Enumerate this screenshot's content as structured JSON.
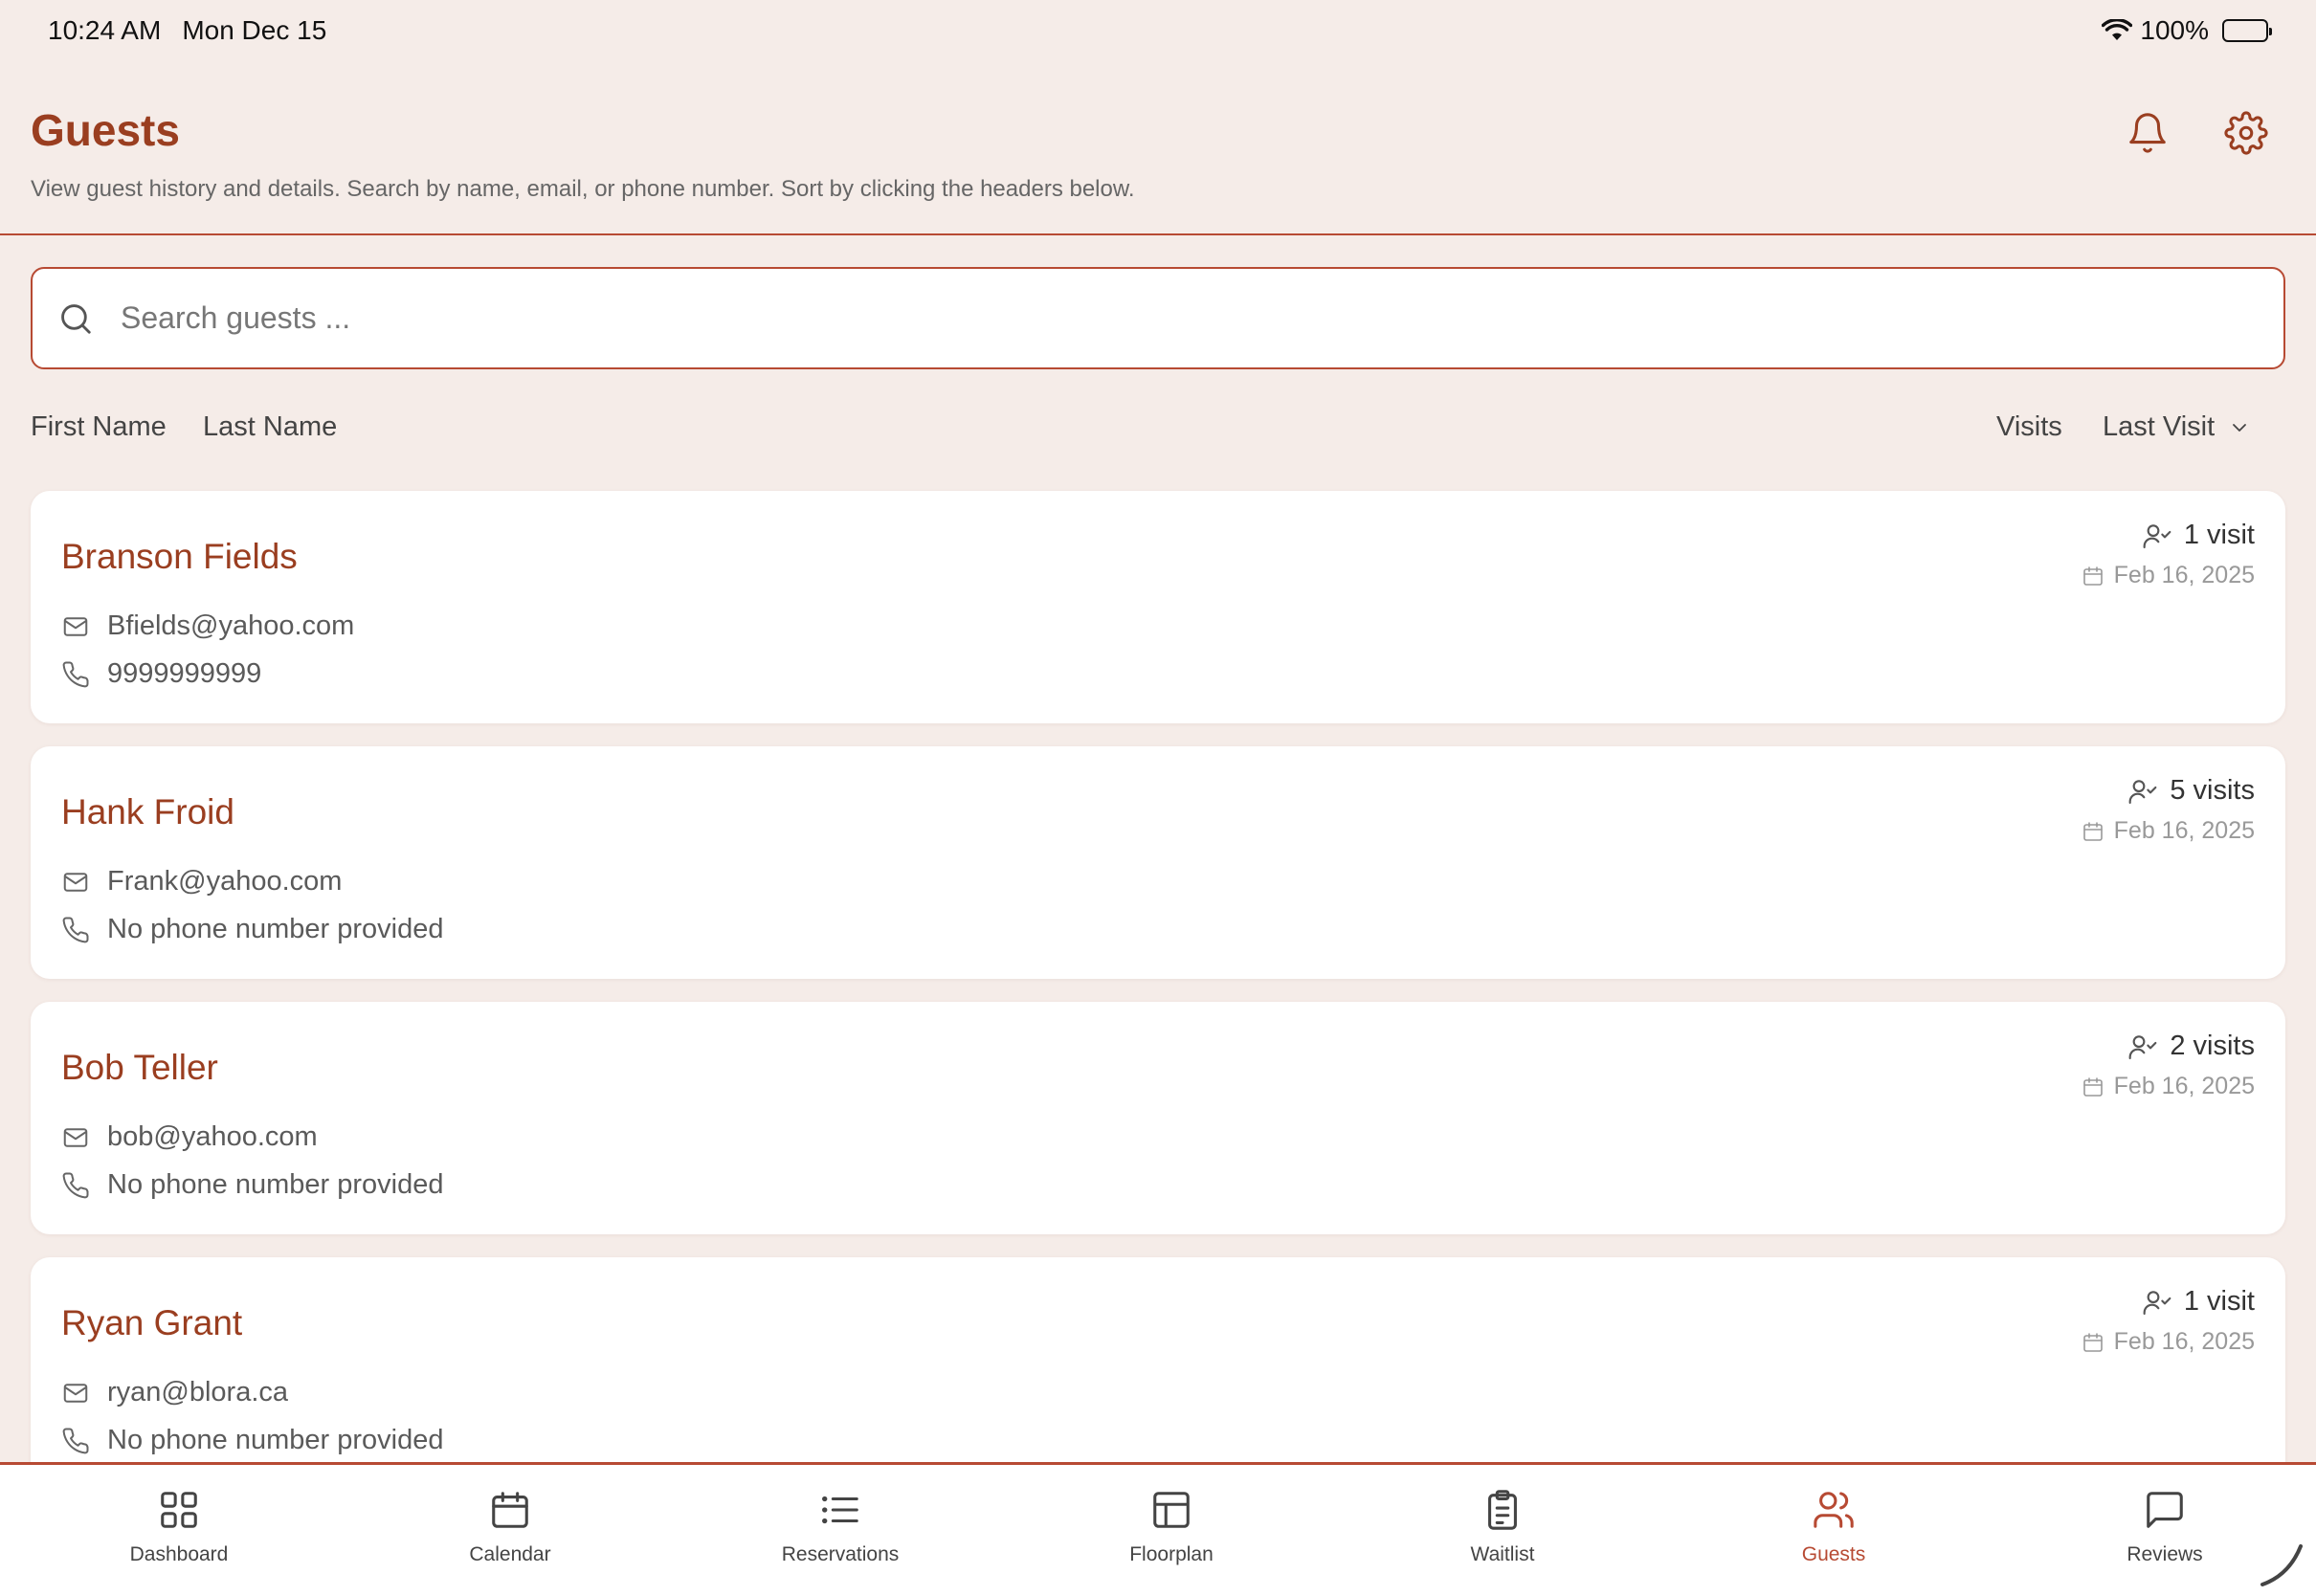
{
  "status_bar": {
    "time": "10:24 AM",
    "date": "Mon Dec 15",
    "battery": "100%"
  },
  "header": {
    "title": "Guests",
    "subtitle": "View guest history and details. Search by name, email, or phone number. Sort by clicking the headers below."
  },
  "search": {
    "placeholder": "Search guests ...",
    "value": ""
  },
  "sort_headers": {
    "first_name": "First Name",
    "last_name": "Last Name",
    "visits": "Visits",
    "last_visit": "Last Visit"
  },
  "guests": [
    {
      "name": "Branson Fields",
      "email": "Bfields@yahoo.com",
      "phone": "9999999999",
      "visits": "1 visit",
      "last_visit": "Feb 16, 2025"
    },
    {
      "name": "Hank Froid",
      "email": "Frank@yahoo.com",
      "phone": "No phone number provided",
      "visits": "5 visits",
      "last_visit": "Feb 16, 2025"
    },
    {
      "name": "Bob Teller",
      "email": "bob@yahoo.com",
      "phone": "No phone number provided",
      "visits": "2 visits",
      "last_visit": "Feb 16, 2025"
    },
    {
      "name": "Ryan Grant",
      "email": "ryan@blora.ca",
      "phone": "No phone number provided",
      "visits": "1 visit",
      "last_visit": "Feb 16, 2025"
    }
  ],
  "tabs": [
    {
      "label": "Dashboard",
      "icon": "grid-icon"
    },
    {
      "label": "Calendar",
      "icon": "calendar-icon"
    },
    {
      "label": "Reservations",
      "icon": "list-icon"
    },
    {
      "label": "Floorplan",
      "icon": "layout-icon"
    },
    {
      "label": "Waitlist",
      "icon": "clipboard-icon"
    },
    {
      "label": "Guests",
      "icon": "users-icon",
      "active": true
    },
    {
      "label": "Reviews",
      "icon": "message-icon"
    }
  ],
  "colors": {
    "accent": "#b74a33",
    "title": "#9a3e20",
    "background": "#f5ece8"
  }
}
